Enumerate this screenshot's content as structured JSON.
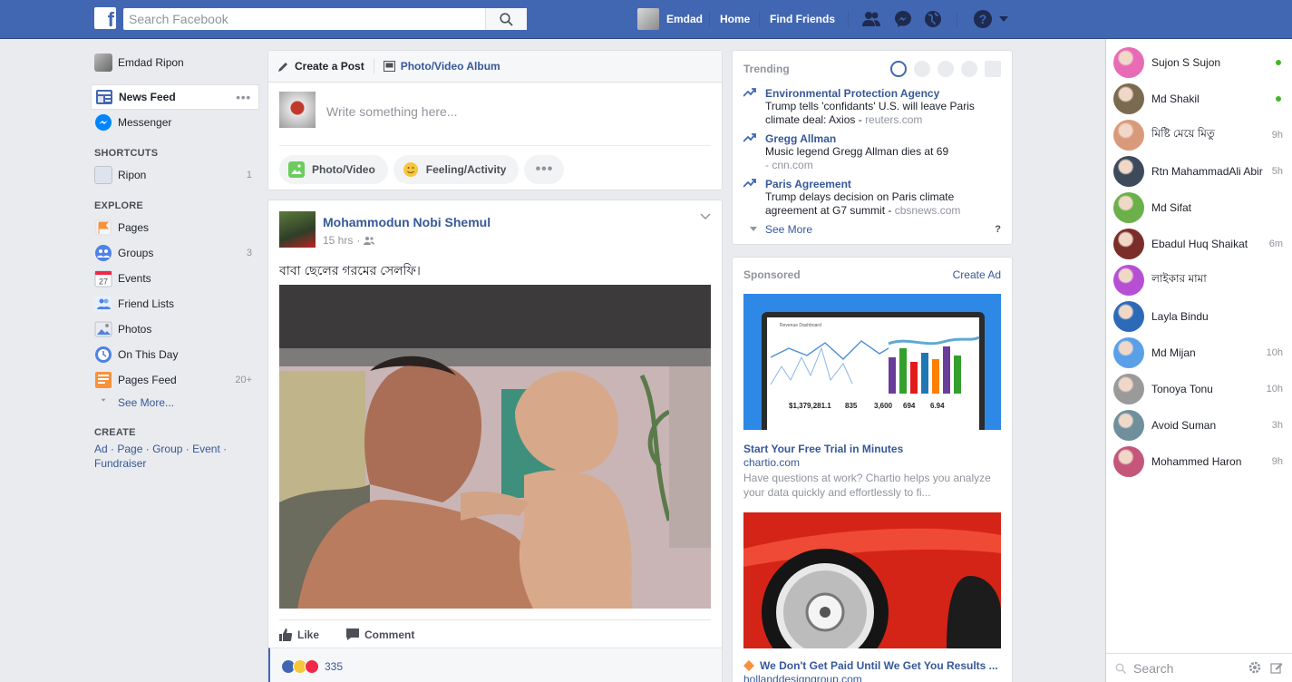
{
  "header": {
    "logo_letter": "f",
    "search_placeholder": "Search Facebook",
    "user_name": "Emdad",
    "nav": [
      "Home",
      "Find Friends"
    ],
    "icons": [
      "friend-requests-icon",
      "messenger-icon",
      "globe-icon",
      "help-icon",
      "dropdown-arrow-icon"
    ],
    "brand_color": "#4267b2"
  },
  "left_nav": {
    "profile_name": "Emdad Ripon",
    "main": [
      {
        "label": "News Feed",
        "icon": "news-feed-icon",
        "active": true
      },
      {
        "label": "Messenger",
        "icon": "messenger-icon"
      }
    ],
    "shortcuts_heading": "SHORTCUTS",
    "shortcuts": [
      {
        "label": "Ripon",
        "count": "1"
      }
    ],
    "explore_heading": "EXPLORE",
    "explore": [
      {
        "label": "Pages",
        "icon": "flag-icon",
        "count": ""
      },
      {
        "label": "Groups",
        "icon": "groups-icon",
        "count": "3"
      },
      {
        "label": "Events",
        "icon": "calendar-icon",
        "count": "",
        "icon_text": "27"
      },
      {
        "label": "Friend Lists",
        "icon": "friend-lists-icon",
        "count": ""
      },
      {
        "label": "Photos",
        "icon": "photos-icon",
        "count": ""
      },
      {
        "label": "On This Day",
        "icon": "clock-icon",
        "count": ""
      },
      {
        "label": "Pages Feed",
        "icon": "pages-feed-icon",
        "count": "20+"
      }
    ],
    "see_more": "See More...",
    "create_heading": "CREATE",
    "create_links": [
      "Ad",
      "Page",
      "Group",
      "Event",
      "Fundraiser"
    ]
  },
  "composer": {
    "tab_create": "Create a Post",
    "tab_album": "Photo/Video Album",
    "placeholder": "Write something here...",
    "actions": [
      "Photo/Video",
      "Feeling/Activity"
    ],
    "more": "•••"
  },
  "post": {
    "author": "Mohammodun Nobi Shemul",
    "time": "15 hrs",
    "text": "বাবা ছেলের গরমের সেলফি।",
    "like_label": "Like",
    "comment_label": "Comment",
    "reaction_count": "335"
  },
  "trending": {
    "heading": "Trending",
    "items": [
      {
        "title": "Environmental Protection Agency",
        "desc": "Trump tells 'confidants' U.S. will leave Paris climate deal: Axios",
        "source": "reuters.com"
      },
      {
        "title": "Gregg Allman",
        "desc": "Music legend Gregg Allman dies at 69",
        "source": "cnn.com"
      },
      {
        "title": "Paris Agreement",
        "desc": "Trump delays decision on Paris climate agreement at G7 summit",
        "source": "cbsnews.com"
      }
    ],
    "see_more": "See More",
    "help": "?"
  },
  "sponsored": {
    "heading": "Sponsored",
    "create_ad": "Create Ad",
    "ad1": {
      "title": "Start Your Free Trial in Minutes",
      "host": "chartio.com",
      "desc": "Have questions at work? Chartio helps you analyze your data quickly and effortlessly to fi...",
      "screen_title": "Revenue Dashboard",
      "stats": [
        "$1,379,281.1",
        "835",
        "3,600",
        "694",
        "6.94"
      ]
    },
    "ad2": {
      "title": "We Don't Get Paid Until We Get You Results ...",
      "host": "hollanddesigngroup.com"
    }
  },
  "chat": {
    "contacts": [
      {
        "name": "Sujon S Sujon",
        "status": "online",
        "color": "#e86bb5"
      },
      {
        "name": "Md Shakil",
        "status": "online",
        "color": "#7a6a4f"
      },
      {
        "name": "মিষ্টি মেয়ে মিতু",
        "status": "9h",
        "color": "#d99a7b"
      },
      {
        "name": "Rtn MahammadAli Abir",
        "status": "5h",
        "color": "#3d4a5c"
      },
      {
        "name": "Md Sifat",
        "status": "",
        "color": "#6bb04a"
      },
      {
        "name": "Ebadul Huq Shaikat",
        "status": "6m",
        "color": "#7b2d2a"
      },
      {
        "name": "লাইকার মামা",
        "status": "",
        "color": "#b64fd3"
      },
      {
        "name": "Layla Bindu",
        "status": "",
        "color": "#2c6ab8"
      },
      {
        "name": "Md Mijan",
        "status": "10h",
        "color": "#5aa0e8"
      },
      {
        "name": "Tonoya Tonu",
        "status": "10h",
        "color": "#9a9a9a"
      },
      {
        "name": "Avoid Suman",
        "status": "3h",
        "color": "#6f8f9c"
      },
      {
        "name": "Mohammed Haron",
        "status": "9h",
        "color": "#c4567a"
      }
    ],
    "search_placeholder": "Search"
  }
}
